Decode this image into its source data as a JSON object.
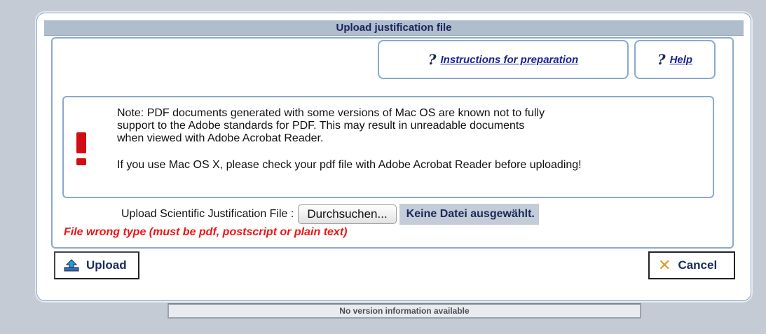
{
  "dialog": {
    "title": "Upload justification file"
  },
  "help_buttons": {
    "instructions_label": "Instructions for preparation",
    "help_label": "Help",
    "icon": "question-mark-icon"
  },
  "note": {
    "icon": "exclamation-icon",
    "paragraph1_line1": "Note: PDF documents generated with some versions of Mac OS are known not to fully",
    "paragraph1_line2": "support to the Adobe standards for PDF. This may result in unreadable documents",
    "paragraph1_line3": "when viewed with Adobe Acrobat Reader.",
    "paragraph2": "If you use Mac OS X, please check your pdf file with Adobe Acrobat Reader before uploading!"
  },
  "upload_field": {
    "label": "Upload Scientific Justification File :",
    "browse_label": "Durchsuchen...",
    "no_file_text": "Keine Datei ausgewählt."
  },
  "error_message": "File wrong type (must be pdf, postscript or plain text)",
  "actions": {
    "upload_label": "Upload",
    "cancel_label": "Cancel"
  },
  "footer": {
    "version_text": "No version information available"
  },
  "colors": {
    "accent": "#1b2a58",
    "error": "#ee1414",
    "warning_icon": "#d10e16",
    "cancel_icon": "#e49a1a"
  }
}
